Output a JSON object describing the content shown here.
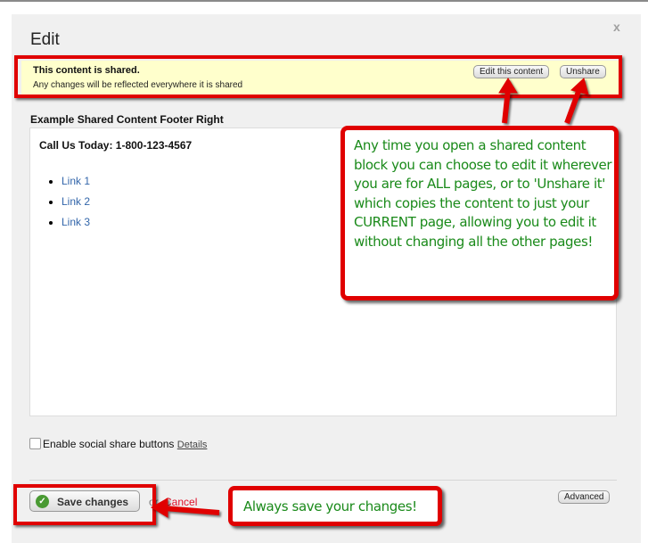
{
  "dialog": {
    "title": "Edit",
    "close_label": "x"
  },
  "banner": {
    "heading": "This content is shared.",
    "subtext": "Any changes will be reflected everywhere it is shared",
    "edit_button": "Edit this content",
    "unshare_button": "Unshare"
  },
  "content": {
    "section_label": "Example Shared Content Footer Right",
    "phone_line": "Call Us Today: 1-800-123-4567",
    "links": [
      "Link 1",
      "Link 2",
      "Link 3"
    ]
  },
  "options": {
    "social_share_label": "Enable social share buttons",
    "social_share_checked": false,
    "details_link": "Details"
  },
  "footer": {
    "save_button": "Save changes",
    "or_text": "or",
    "cancel_link": "Cancel",
    "advanced_button": "Advanced"
  },
  "annotations": {
    "shared_callout": "Any time you open a shared content block you can choose to edit it wherever you are for ALL pages, or to 'Unshare it' which copies the content to just your CURRENT page, allowing you to edit it without changing all the other pages!",
    "save_callout": "Always save your changes!",
    "highlight_color": "#e00000",
    "text_color": "#1a8a1a"
  }
}
